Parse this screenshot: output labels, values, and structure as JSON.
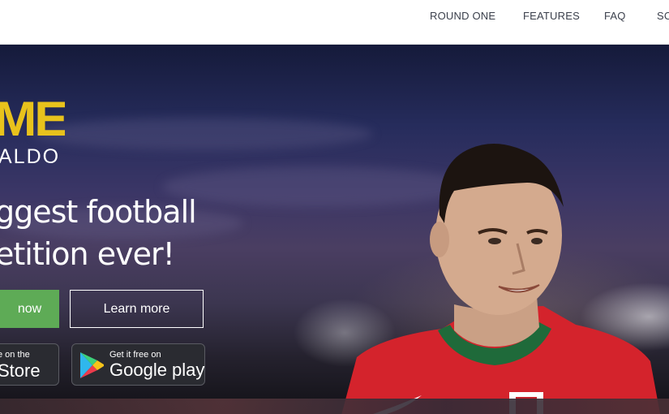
{
  "nav": {
    "items": [
      "ROUND ONE",
      "FEATURES",
      "FAQ",
      "SC"
    ]
  },
  "hero": {
    "logo_main": "ME",
    "logo_sub": "ALDO",
    "headline_line1": "ggest football",
    "headline_line2": "etition ever!",
    "primary_button": "now",
    "secondary_button": "Learn more",
    "apple_store": {
      "small": "e on the",
      "big": "Store"
    },
    "google_play": {
      "small": "Get it free on",
      "big": "Google play"
    }
  },
  "colors": {
    "accent_green": "#5eab56",
    "logo_gold": "#e8c21c",
    "jersey_red": "#d4232c"
  },
  "icons": [
    "google-play-icon"
  ]
}
